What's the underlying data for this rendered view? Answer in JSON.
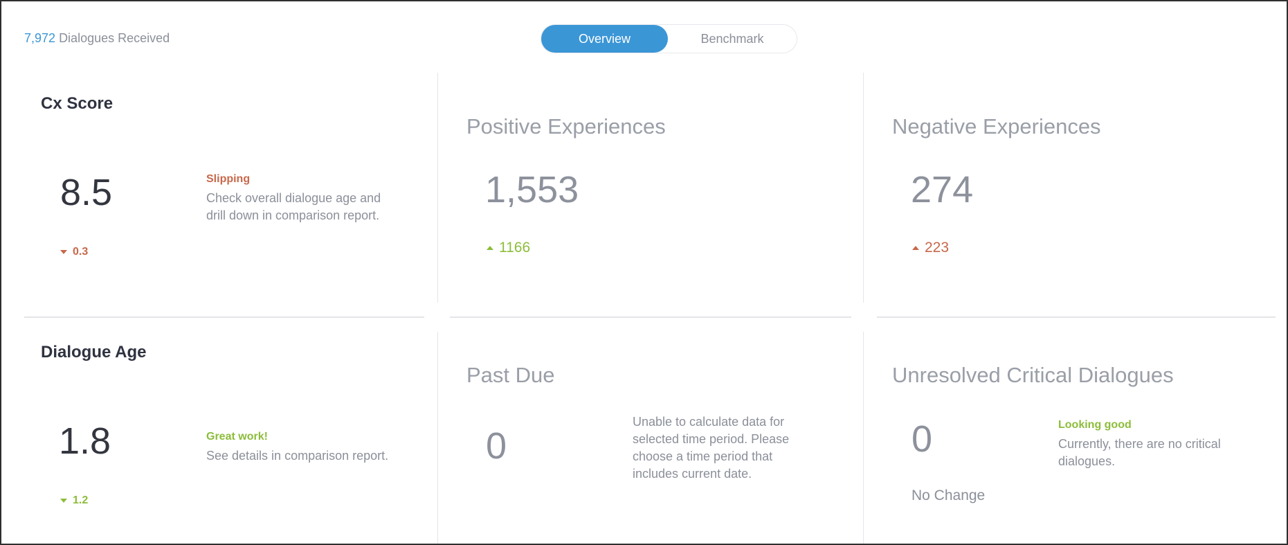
{
  "header": {
    "received_count": "7,972",
    "received_label": "Dialogues Received"
  },
  "toggle": {
    "overview": "Overview",
    "benchmark": "Benchmark",
    "active": "Overview"
  },
  "cards": {
    "cx_score": {
      "title": "Cx Score",
      "value": "8.5",
      "status": "Slipping",
      "status_color": "#c8684b",
      "desc_line1": "Check overall dialogue age and",
      "desc_line2": "drill down in comparison report.",
      "delta": "0.3",
      "delta_direction": "down"
    },
    "positive": {
      "title": "Positive Experiences",
      "value": "1,553",
      "delta": "1166",
      "delta_direction": "up"
    },
    "negative": {
      "title": "Negative Experiences",
      "value": "274",
      "delta": "223",
      "delta_direction": "up"
    },
    "dialogue_age": {
      "title": "Dialogue Age",
      "value": "1.8",
      "status": "Great work!",
      "status_color": "#8cbd3b",
      "desc": "See details in comparison report.",
      "delta": "1.2",
      "delta_direction": "down"
    },
    "past_due": {
      "title": "Past Due",
      "value": "0",
      "desc_line1": "Unable to calculate data for",
      "desc_line2": "selected time period. Please",
      "desc_line3": "choose a time period that",
      "desc_line4": "includes current date."
    },
    "unresolved": {
      "title": "Unresolved Critical Dialogues",
      "value": "0",
      "status": "Looking good",
      "status_color": "#8cbd3b",
      "desc_line1": "Currently, there are no critical",
      "desc_line2": "dialogues.",
      "change": "No Change"
    }
  },
  "colors": {
    "accent": "#3b96d6",
    "negative": "#c8684b",
    "positive": "#8cbd3b"
  }
}
